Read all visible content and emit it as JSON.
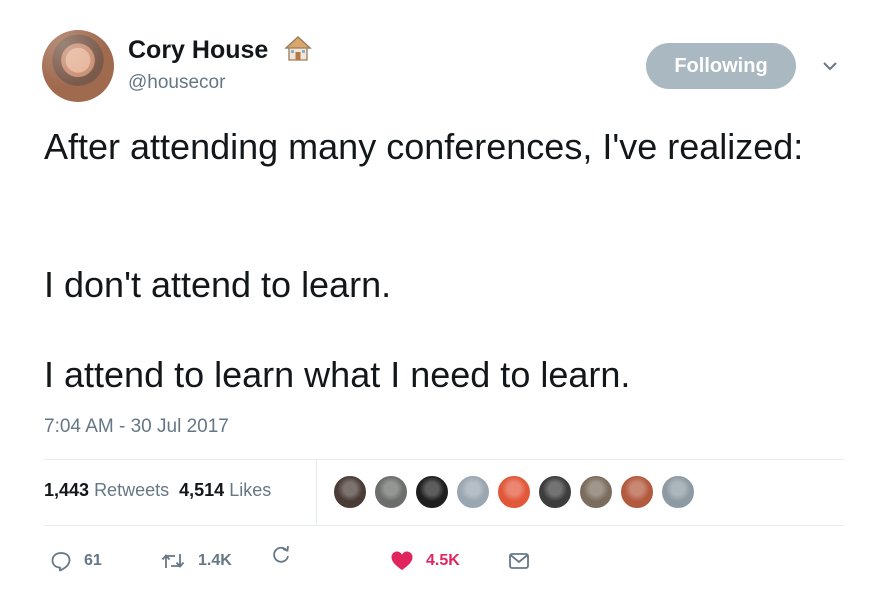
{
  "author": {
    "name": "Cory House",
    "handle": "@housecor",
    "name_emoji_icon": "house-icon"
  },
  "follow_button": {
    "label": "Following"
  },
  "tweet": {
    "paragraphs": [
      "After attending many conferences, I've realized:",
      "I don't attend to learn.",
      "I attend to learn what I need to learn."
    ],
    "timestamp": "7:04 AM - 30 Jul 2017"
  },
  "stats": {
    "retweets_count": "1,443",
    "retweets_label": "Retweets",
    "likes_count": "4,514",
    "likes_label": "Likes"
  },
  "likers": {
    "avatar_colors": [
      "#4a3b36",
      "#6b6e6a",
      "#1f1f1f",
      "#9aa6b0",
      "#e2573a",
      "#3d3d3d",
      "#7b6d5e",
      "#b35a3e",
      "#8e9aa3"
    ]
  },
  "actions": {
    "reply_count": "61",
    "retweet_count": "1.4K",
    "like_count": "4.5K",
    "icons": [
      "reply-icon",
      "retweet-icon",
      "sync-icon",
      "heart-icon",
      "mail-icon"
    ]
  },
  "colors": {
    "text": "#14171a",
    "secondary": "#657786",
    "following_button": "#aab8c2",
    "like_red": "#e0245e",
    "divider": "#e6ecf0"
  }
}
